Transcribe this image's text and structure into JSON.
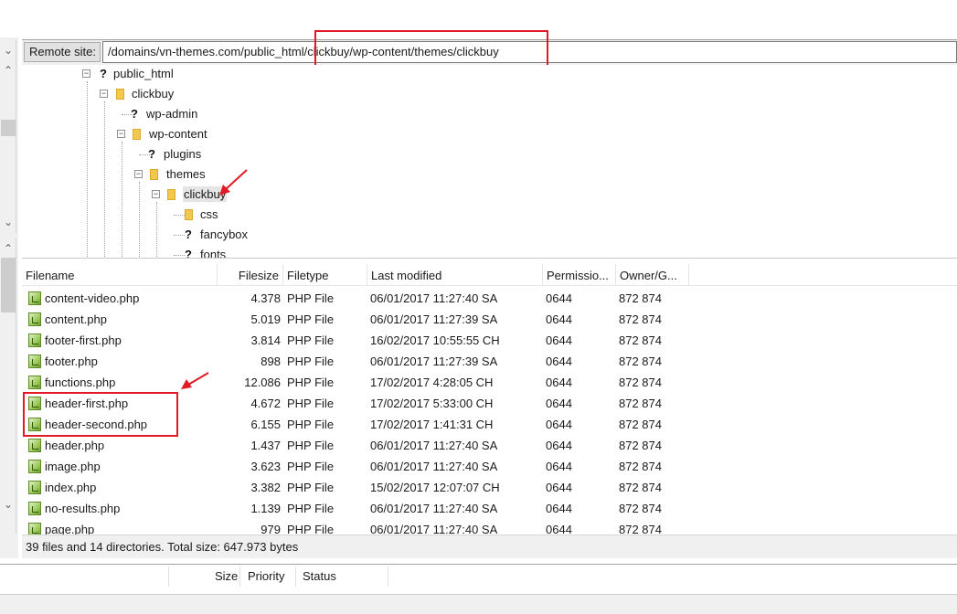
{
  "remote_site": {
    "label": "Remote site:",
    "path": "/domains/vn-themes.com/public_html/clickbuy/wp-content/themes/clickbuy"
  },
  "tree": {
    "nodes": [
      {
        "label": "public_html",
        "icon": "question-icon",
        "expanded": true
      },
      {
        "label": "clickbuy",
        "icon": "folder-icon",
        "expanded": true
      },
      {
        "label": "wp-admin",
        "icon": "question-icon"
      },
      {
        "label": "wp-content",
        "icon": "folder-icon",
        "expanded": true
      },
      {
        "label": "plugins",
        "icon": "question-icon"
      },
      {
        "label": "themes",
        "icon": "folder-icon",
        "expanded": true
      },
      {
        "label": "clickbuy",
        "icon": "folder-icon",
        "expanded": true,
        "selected": true
      },
      {
        "label": "css",
        "icon": "folder-icon"
      },
      {
        "label": "fancybox",
        "icon": "question-icon"
      },
      {
        "label": "fonts",
        "icon": "question-icon"
      }
    ]
  },
  "file_list": {
    "columns": [
      "Filename",
      "Filesize",
      "Filetype",
      "Last modified",
      "Permissio...",
      "Owner/G..."
    ],
    "rows": [
      {
        "name": "content-video.php",
        "size": "4.378",
        "type": "PHP File",
        "modified": "06/01/2017 11:27:40 SA",
        "perm": "0644",
        "owner": "872 874"
      },
      {
        "name": "content.php",
        "size": "5.019",
        "type": "PHP File",
        "modified": "06/01/2017 11:27:39 SA",
        "perm": "0644",
        "owner": "872 874"
      },
      {
        "name": "footer-first.php",
        "size": "3.814",
        "type": "PHP File",
        "modified": "16/02/2017 10:55:55 CH",
        "perm": "0644",
        "owner": "872 874"
      },
      {
        "name": "footer.php",
        "size": "898",
        "type": "PHP File",
        "modified": "06/01/2017 11:27:39 SA",
        "perm": "0644",
        "owner": "872 874"
      },
      {
        "name": "functions.php",
        "size": "12.086",
        "type": "PHP File",
        "modified": "17/02/2017 4:28:05 CH",
        "perm": "0644",
        "owner": "872 874"
      },
      {
        "name": "header-first.php",
        "size": "4.672",
        "type": "PHP File",
        "modified": "17/02/2017 5:33:00 CH",
        "perm": "0644",
        "owner": "872 874"
      },
      {
        "name": "header-second.php",
        "size": "6.155",
        "type": "PHP File",
        "modified": "17/02/2017 1:41:31 CH",
        "perm": "0644",
        "owner": "872 874"
      },
      {
        "name": "header.php",
        "size": "1.437",
        "type": "PHP File",
        "modified": "06/01/2017 11:27:40 SA",
        "perm": "0644",
        "owner": "872 874"
      },
      {
        "name": "image.php",
        "size": "3.623",
        "type": "PHP File",
        "modified": "06/01/2017 11:27:40 SA",
        "perm": "0644",
        "owner": "872 874"
      },
      {
        "name": "index.php",
        "size": "3.382",
        "type": "PHP File",
        "modified": "15/02/2017 12:07:07 CH",
        "perm": "0644",
        "owner": "872 874"
      },
      {
        "name": "no-results.php",
        "size": "1.139",
        "type": "PHP File",
        "modified": "06/01/2017 11:27:40 SA",
        "perm": "0644",
        "owner": "872 874"
      },
      {
        "name": "page.php",
        "size": "979",
        "type": "PHP File",
        "modified": "06/01/2017 11:27:40 SA",
        "perm": "0644",
        "owner": "872 874"
      }
    ]
  },
  "status": {
    "summary": "39 files and 14 directories. Total size: 647.973 bytes"
  },
  "queue": {
    "columns": [
      "Size",
      "Priority",
      "Status"
    ]
  },
  "annotations": {
    "highlight_color": "#e01b24"
  }
}
